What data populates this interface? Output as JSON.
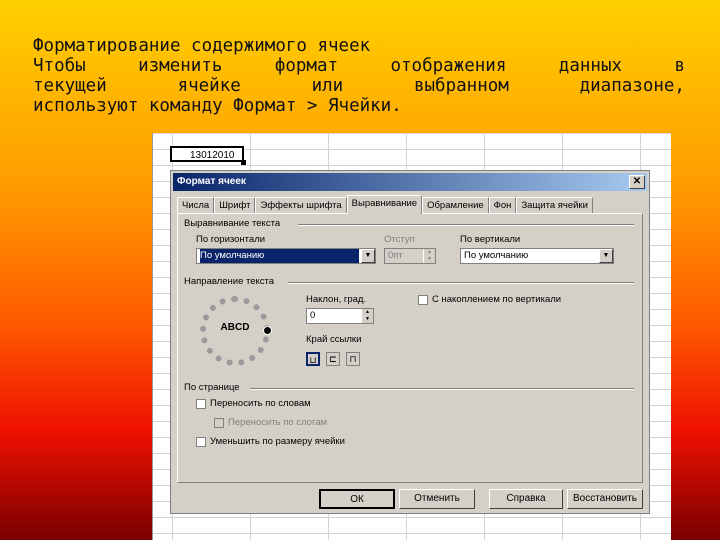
{
  "slide": {
    "title": "Форматирование содержимого ячеек",
    "lines": [
      [
        "Чтобы",
        "изменить",
        "формат",
        "отображения",
        "данных",
        "в"
      ],
      [
        "текущей",
        "ячейке",
        "или",
        "выбранном",
        "диапазоне,"
      ],
      [
        "используют команду Формат > Ячейки."
      ]
    ]
  },
  "sheet": {
    "cell_value": "13012010"
  },
  "dialog": {
    "title": "Формат ячеек",
    "close_glyph": "✕",
    "tabs": [
      "Числа",
      "Шрифт",
      "Эффекты шрифта",
      "Выравнивание",
      "Обрамление",
      "Фон",
      "Защита ячейки"
    ],
    "active_tab": "Выравнивание",
    "text_alignment": {
      "section": "Выравнивание текста",
      "horizontal_label": "По горизонтали",
      "horizontal_value": "По умолчанию",
      "indent_label": "Отступ",
      "indent_value": "0пт",
      "vertical_label": "По вертикали",
      "vertical_value": "По умолчанию"
    },
    "text_direction": {
      "section": "Направление текста",
      "dial_text": "ABCD",
      "angle_label": "Наклон, град.",
      "angle_value": "0",
      "reference_edge_label": "Край ссылки",
      "stacked_label": "С накоплением по вертикали",
      "edge_buttons": [
        "⊔",
        "⊏",
        "⊓"
      ]
    },
    "properties": {
      "section": "По странице",
      "wrap_label": "Переносить по словам",
      "hyphenate_label": "Переносить по слогам",
      "shrink_label": "Уменьшить по размеру ячейки"
    },
    "buttons": {
      "ok": "ОК",
      "cancel": "Отменить",
      "help": "Справка",
      "reset": "Восстановить"
    },
    "colors": {
      "face": "#d4d0c8",
      "title_start": "#0a246a",
      "title_end": "#a6caf0"
    }
  }
}
